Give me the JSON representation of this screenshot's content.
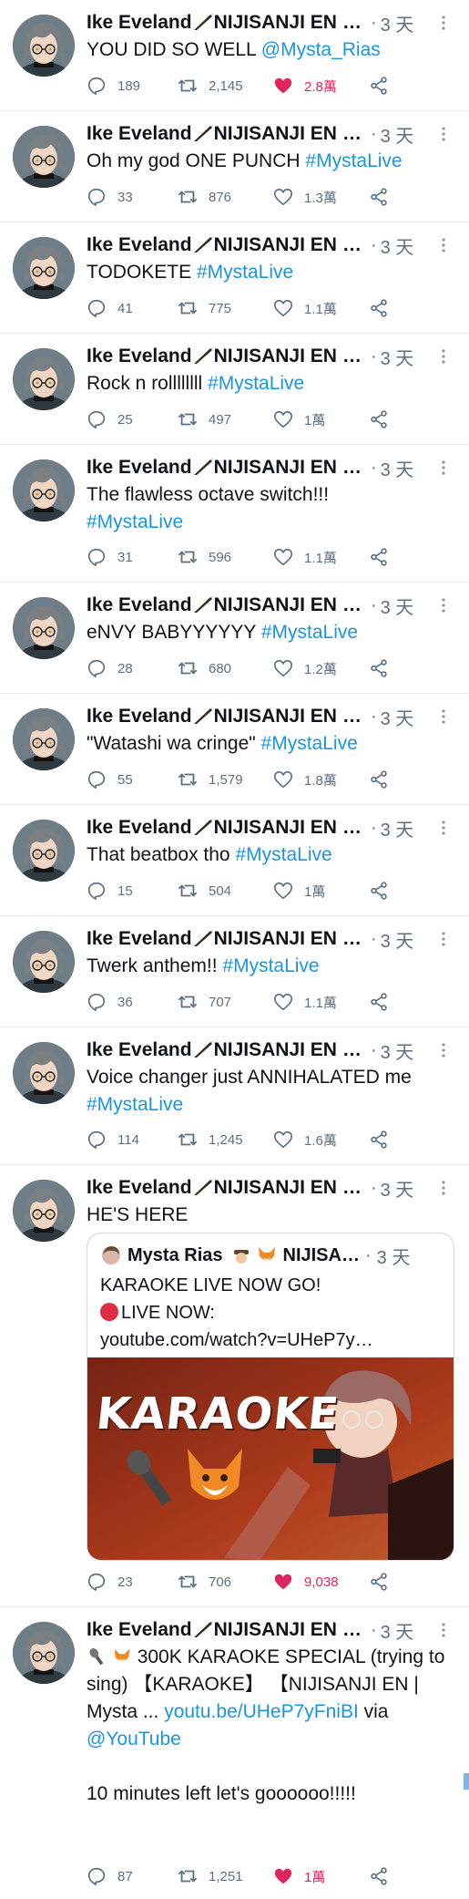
{
  "author": {
    "name": "Ike Eveland",
    "affiliation": "NIJISANJI EN",
    "ellipsis": "…"
  },
  "common": {
    "sep": "·",
    "time": "3 天"
  },
  "tweets": [
    {
      "text": "YOU DID SO WELL ",
      "link": "@Mysta_Rias",
      "reply": "189",
      "retweet": "2,145",
      "like": "2.8萬",
      "liked": true
    },
    {
      "text": "Oh my god ONE PUNCH ",
      "link": "#MystaLive",
      "reply": "33",
      "retweet": "876",
      "like": "1.3萬",
      "liked": false
    },
    {
      "text": "TODOKETE ",
      "link": "#MystaLive",
      "reply": "41",
      "retweet": "775",
      "like": "1.1萬",
      "liked": false
    },
    {
      "text": "Rock n rollllllll ",
      "link": "#MystaLive",
      "reply": "25",
      "retweet": "497",
      "like": "1萬",
      "liked": false
    },
    {
      "text": "The flawless octave switch!!!",
      "link": "#MystaLive",
      "reply": "31",
      "retweet": "596",
      "like": "1.1萬",
      "liked": false
    },
    {
      "text": "eNVY BABYYYYYY ",
      "link": "#MystaLive",
      "reply": "28",
      "retweet": "680",
      "like": "1.2萬",
      "liked": false
    },
    {
      "text": "\"Watashi wa cringe\" ",
      "link": "#MystaLive",
      "reply": "55",
      "retweet": "1,579",
      "like": "1.8萬",
      "liked": false
    },
    {
      "text": "That beatbox tho ",
      "link": "#MystaLive",
      "reply": "15",
      "retweet": "504",
      "like": "1萬",
      "liked": false
    },
    {
      "text": "Twerk anthem!! ",
      "link": "#MystaLive",
      "reply": "36",
      "retweet": "707",
      "like": "1.1萬",
      "liked": false
    },
    {
      "text": "Voice changer just ANNIHALATED me",
      "link": "#MystaLive",
      "reply": "114",
      "retweet": "1,245",
      "like": "1.6萬",
      "liked": false
    },
    {
      "text": "HE'S HERE",
      "reply": "23",
      "retweet": "706",
      "like": "9,038",
      "liked": true,
      "quote": {
        "name": "Mysta Rias",
        "affiliation": "NIJISA…",
        "time": "3 天",
        "line1": "KARAOKE LIVE NOW GO!",
        "line2": "LIVE NOW:",
        "line3": "youtube.com/watch?v=UHeP7y…",
        "image_text": "KARAOKE"
      }
    },
    {
      "text_pre": "300K KARAOKE SPECIAL (trying to sing) 【KARAOKE】 【NIJISANJI EN | Mysta ... ",
      "link": "youtu.be/UHeP7yFniBI",
      "via": " via ",
      "link2": "@YouTube",
      "text_post": "10 minutes left let's goooooo!!!!!",
      "reply": "87",
      "retweet": "1,251",
      "like": "1萬",
      "liked": true
    }
  ],
  "colors": {
    "link": "#1b95e0",
    "like_active": "#e0245e",
    "muted": "#5b7083",
    "divider": "#e6ecf0"
  }
}
